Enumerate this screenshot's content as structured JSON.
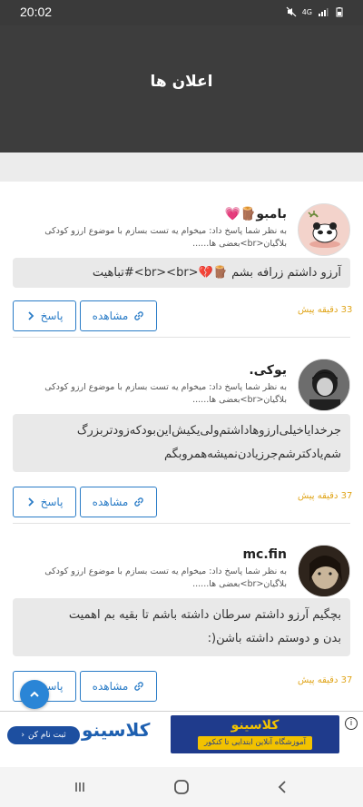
{
  "status_bar": {
    "time": "20:02",
    "network": "4G"
  },
  "header": {
    "title": "اعلان ها"
  },
  "notifications": [
    {
      "name": "بامبو🪵💗",
      "description": "به نظر شما پاسخ داد: میخوام یه تست بسازم با موضوع ارزو کودکی بلاگیان<br>بعضی ها......",
      "message": "آرزو داشتم زرافه بشم 🪵💔<br><br>#تباهیت",
      "time": "33 دقیقه پیش",
      "view_label": "مشاهده",
      "reply_label": "پاسخ"
    },
    {
      "name": "یوکی.",
      "description": "به نظر شما پاسخ داد: میخوام یه تست بسازم با موضوع ارزو کودکی بلاگیان<br>بعضی ها......",
      "message_lines": [
        "جرخدایاخیلی‌ارزوهاداشتم‌ولی‌یکیش‌این‌بودکه‌زودتربزرگ",
        "شم‌یادکترشم‌جرزیادن‌نمیشه‌همروبگم"
      ],
      "time": "37 دقیقه پیش",
      "view_label": "مشاهده",
      "reply_label": "پاسخ"
    },
    {
      "name": "mc.fin",
      "description": "به نظر شما پاسخ داد: میخوام یه تست بسازم با موضوع ارزو کودکی بلاگیان<br>بعضی ها......",
      "message_lines": [
        "بچگیم آرزو داشتم سرطان داشته باشم تا بقیه بم اهمیت",
        "بدن و دوستم داشته باشن(:"
      ],
      "time": "37 دقیقه پیش",
      "view_label": "مشاهده",
      "reply_label": "پاسخ"
    }
  ],
  "ad": {
    "signup_label": "ثبت نام کن",
    "logo_text": "کلاسینو",
    "tagline": "آموزشگاه آنلاین ابتدایی تا کنکور",
    "badge": "i"
  },
  "colors": {
    "accent": "#2a7cc7",
    "time": "#e0a51a",
    "header": "#3d3d3d"
  }
}
